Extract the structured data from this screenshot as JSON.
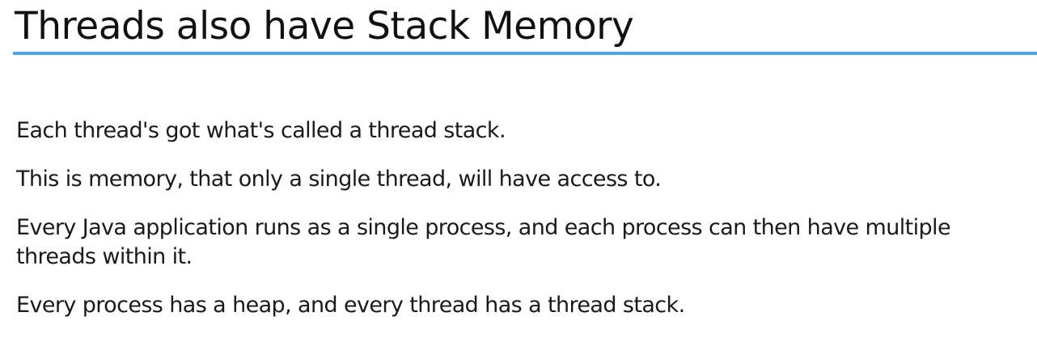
{
  "slide": {
    "title": "Threads also have Stack Memory",
    "accent_color": "#4da3ec",
    "paragraphs": [
      "Each thread's got what's called a thread stack.",
      "This is memory, that only a single thread, will have access to.",
      "Every Java application runs as a single process, and each process can then have multiple threads within it.",
      "Every process has a heap, and every thread has a thread stack."
    ]
  }
}
